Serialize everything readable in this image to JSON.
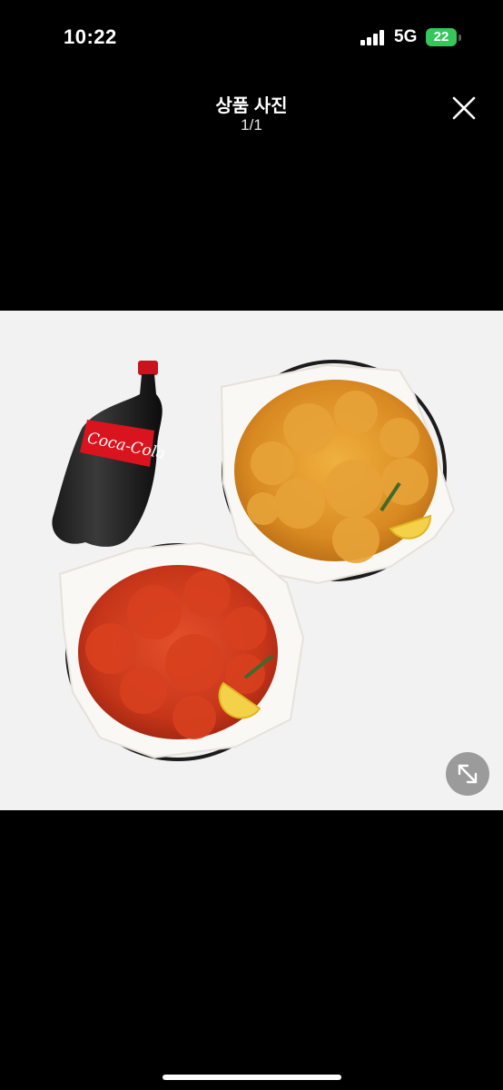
{
  "status_bar": {
    "time": "10:22",
    "network": "5G",
    "battery": "22"
  },
  "header": {
    "title": "상품 사진",
    "counter": "1/1"
  },
  "photo": {
    "bottle_label": "Coca-Cola"
  },
  "icons": {
    "close": "close-icon",
    "expand": "expand-icon",
    "signal": "signal-icon",
    "battery": "battery-icon"
  },
  "colors": {
    "background": "#000000",
    "photo_background": "#f2f2f2",
    "battery_green": "#34c759",
    "expand_button": "#8c8c8c"
  }
}
